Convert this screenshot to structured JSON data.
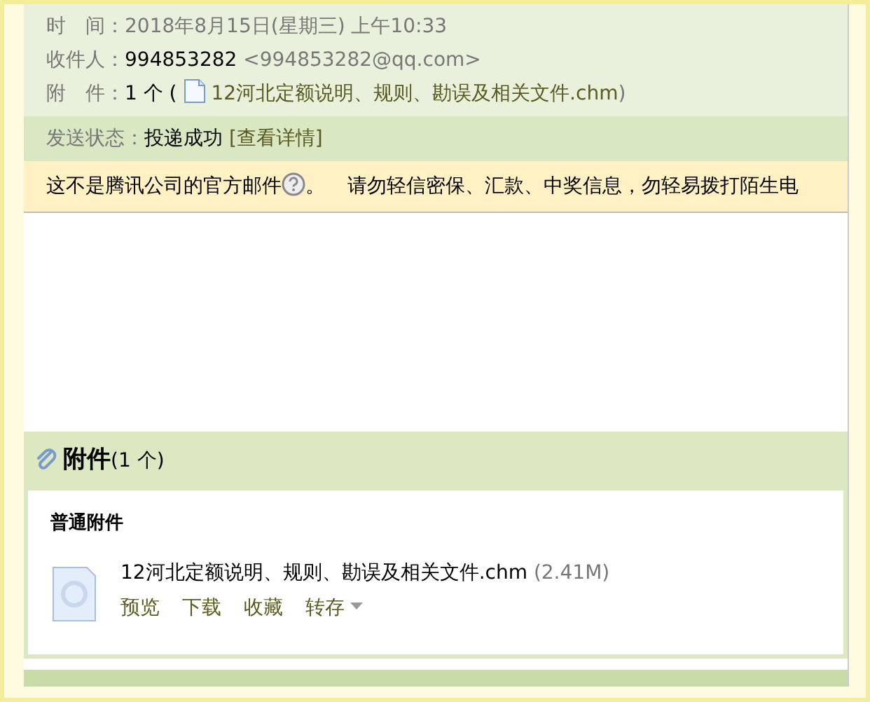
{
  "header": {
    "fields": [
      {
        "kind": "time",
        "label": "时　间：",
        "value": "2018年8月15日(星期三) 上午10:33"
      },
      {
        "kind": "recipient",
        "label": "收件人：",
        "value": "994853282",
        "extra": "<994853282@qq.com>"
      },
      {
        "kind": "attachment",
        "label": "附　件：",
        "value": "1 个 (",
        "link": "12河北定额说明、规则、勘误及相关文件.chm",
        "extra": ")"
      }
    ]
  },
  "status": {
    "label": "发送状态：",
    "value": "投递成功",
    "link": "[查看详情]"
  },
  "warning": {
    "text": "这不是腾讯公司的官方邮件",
    "after": "。",
    "advice": "请勿轻信密保、汇款、中奖信息，勿轻易拨打陌生电"
  },
  "attachments": {
    "title": "附件",
    "count": "(1 个)",
    "group": "普通附件",
    "files": [
      {
        "name": "12河北定额说明、规则、勘误及相关文件.chm",
        "size": "(2.41M)",
        "actions": [
          "预览",
          "下载",
          "收藏",
          "转存"
        ]
      }
    ]
  }
}
